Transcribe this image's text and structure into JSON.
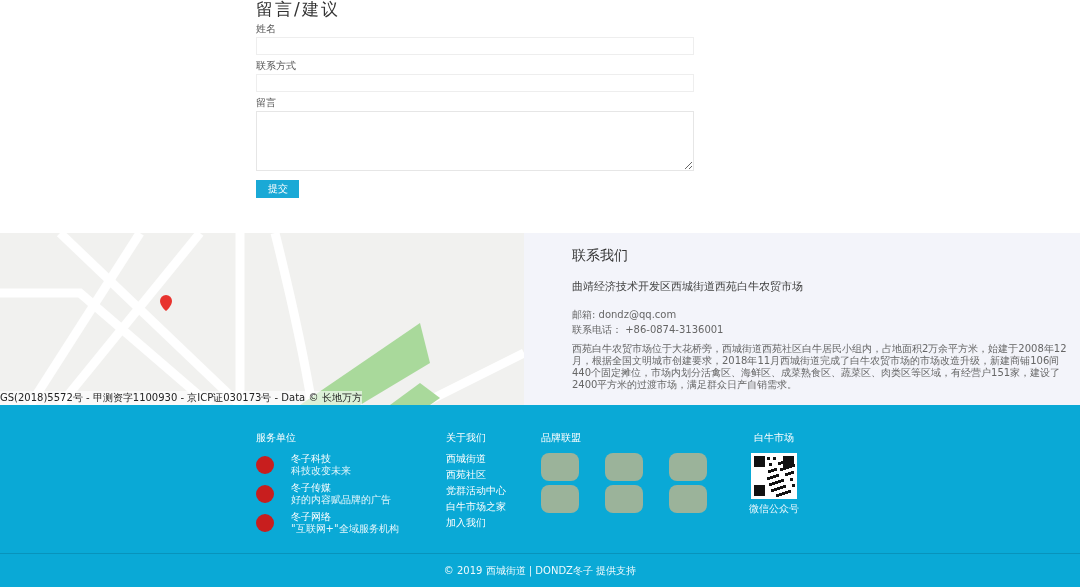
{
  "form": {
    "title": "留言/建议",
    "fields": [
      {
        "kind": "input",
        "label": "姓名"
      },
      {
        "kind": "input",
        "label": "联系方式"
      },
      {
        "kind": "textarea",
        "label": "留言"
      }
    ],
    "submit": "提交"
  },
  "map": {
    "attribution": "GS(2018)5572号 - 甲测资字1100930 - 京ICP证030173号 - Data © 长地万方"
  },
  "contact": {
    "title": "联系我们",
    "address": "曲靖经济技术开发区西城街道西苑白牛农贸市场",
    "email": "邮箱: dondz@qq.com",
    "phone": "联系电话：  +86-0874-3136001",
    "description": "西苑白牛农贸市场位于大花桥旁，西城街道西苑社区白牛居民小组内，占地面积2万余平方米，始建于2008年12月，根据全国文明城市创建要求，2018年11月西城街道完成了白牛农贸市场的市场改造升级，新建商铺106间440个固定摊位，市场内划分活禽区、海鲜区、成菜熟食区、蔬菜区、肉类区等区域，有经营户151家，建设了2400平方米的过渡市场，满足群众日产自销需求。"
  },
  "footer": {
    "services": {
      "title": "服务单位",
      "items": [
        {
          "name": "冬子科技",
          "desc": "科技改变未来"
        },
        {
          "name": "冬子传媒",
          "desc": "好的内容赋品牌的广告"
        },
        {
          "name": "冬子网络",
          "desc": "\"互联网+\"全域服务机构"
        }
      ]
    },
    "about": {
      "title": "关于我们",
      "links": [
        "西城街道",
        "西苑社区",
        "党群活动中心",
        "白牛市场之家",
        "加入我们"
      ]
    },
    "brands": {
      "title": "品牌联盟"
    },
    "market": {
      "title": "白牛市场",
      "qr_caption": "微信公众号"
    },
    "copyright": "© 2019 西城街道  | DONDZ冬子  提供支持"
  }
}
